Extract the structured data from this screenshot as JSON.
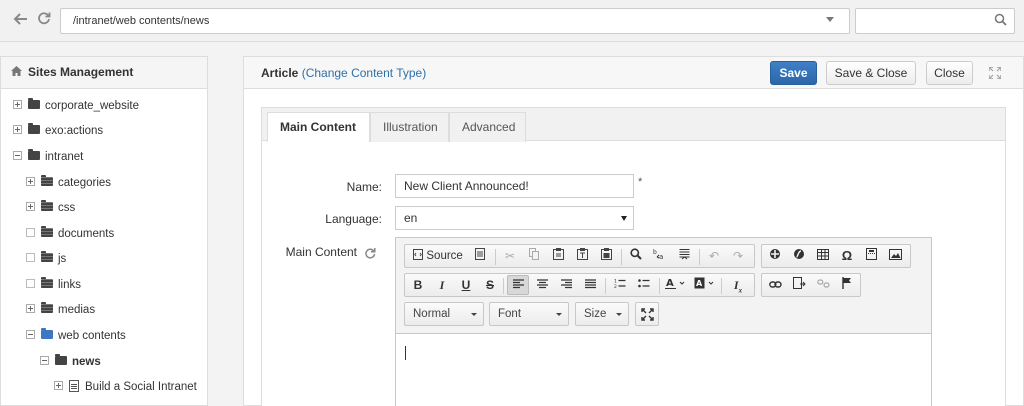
{
  "address_bar": {
    "path": "/intranet/web contents/news",
    "search_value": ""
  },
  "sidebar": {
    "title": "Sites Management",
    "items": [
      {
        "label": "corporate_website",
        "toggle": "plus",
        "icon": "folder"
      },
      {
        "label": "exo:actions",
        "toggle": "plus",
        "icon": "folder"
      },
      {
        "label": "intranet",
        "toggle": "minus",
        "icon": "folder"
      },
      {
        "label": "categories",
        "toggle": "plus",
        "icon": "folder-striped"
      },
      {
        "label": "css",
        "toggle": "plus",
        "icon": "folder-striped"
      },
      {
        "label": "documents",
        "toggle": "none",
        "icon": "folder-striped"
      },
      {
        "label": "js",
        "toggle": "none",
        "icon": "folder-striped"
      },
      {
        "label": "links",
        "toggle": "none",
        "icon": "folder-striped"
      },
      {
        "label": "medias",
        "toggle": "plus",
        "icon": "folder-striped"
      },
      {
        "label": "web contents",
        "toggle": "minus",
        "icon": "folder-blue"
      },
      {
        "label": "news",
        "toggle": "minus",
        "icon": "folder"
      },
      {
        "label": "Build a Social Intranet",
        "toggle": "plus",
        "icon": "document"
      }
    ]
  },
  "main": {
    "title_type": "Article",
    "title_link": "(Change Content Type)",
    "save_label": "Save",
    "save_close_label": "Save & Close",
    "close_label": "Close",
    "tabs": [
      "Main Content",
      "Illustration",
      "Advanced"
    ],
    "form": {
      "name_label": "Name:",
      "name_value": "New Client Announced!",
      "required_mark": "*",
      "language_label": "Language:",
      "language_value": "en",
      "content_label": "Main Content"
    },
    "editor": {
      "source_label": "Source",
      "format_value": "Normal",
      "font_value": "Font",
      "size_value": "Size",
      "body": ""
    }
  },
  "colors": {
    "primary_button": "#2f6fb5",
    "link": "#2f6fa7",
    "folder_active": "#3d77c4"
  }
}
